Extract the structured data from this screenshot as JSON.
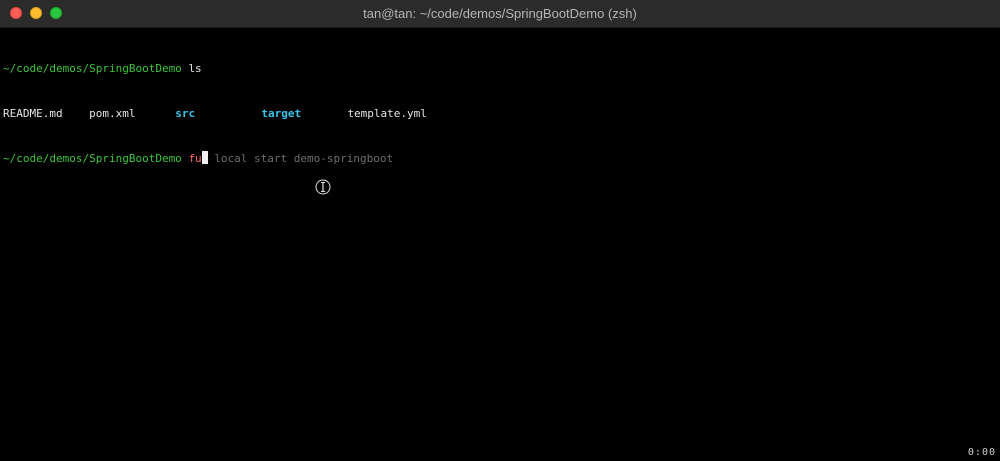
{
  "window": {
    "title": "tan@tan: ~/code/demos/SpringBootDemo (zsh)"
  },
  "terminal": {
    "line1": {
      "prompt": "~/code/demos/SpringBootDemo",
      "command": "ls"
    },
    "listing": {
      "readme": "README.md",
      "pom": "pom.xml",
      "src": "src",
      "target": "target",
      "template": "template.yml"
    },
    "line3": {
      "prompt": "~/code/demos/SpringBootDemo",
      "typed": "fu",
      "suggestion": "local start demo-springboot"
    }
  },
  "status": {
    "clock": "0:00"
  },
  "colors": {
    "prompt": "#3cc43c",
    "directory": "#35c4e8",
    "typed": "#ff6b6b",
    "suggestion": "#6e6e6e"
  }
}
